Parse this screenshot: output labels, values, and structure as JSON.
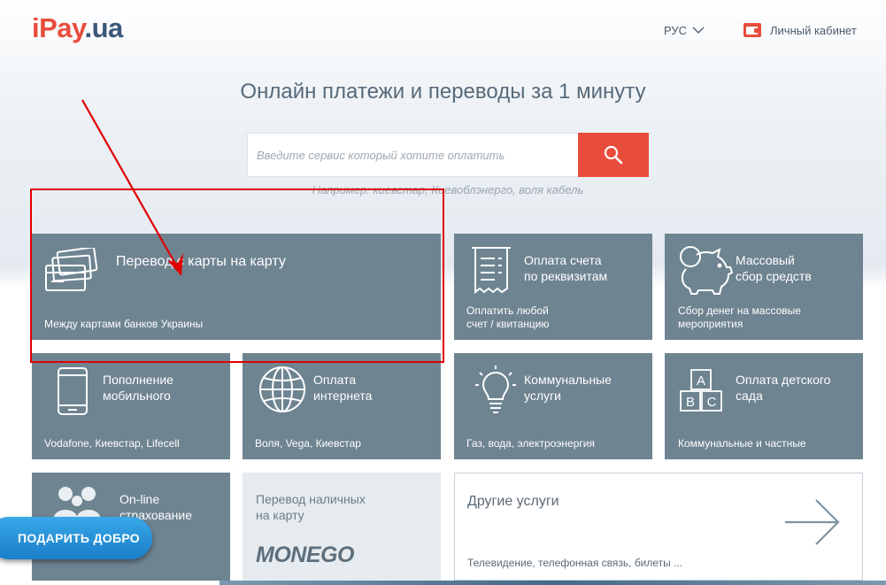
{
  "header": {
    "logo_main": "iPay",
    "logo_dot": ".",
    "logo_ua": "ua",
    "lang": "РУС",
    "cabinet": "Личный кабинет"
  },
  "hero": {
    "headline": "Онлайн платежи и переводы за 1 минуту",
    "search_placeholder": "Введите сервис который хотите оплатить",
    "example": "Например: киевстар, Киевоблэнерго, воля кабель"
  },
  "tiles": {
    "card": {
      "title": "Перевод с карты на карту",
      "sub": "Между картами банков Украины"
    },
    "invoice": {
      "title1": "Оплата счета",
      "title2": "по реквизитам",
      "sub1": "Оплатить любой",
      "sub2": "счет / квитанцию"
    },
    "mass": {
      "title1": "Массовый",
      "title2": "сбор средств",
      "sub1": "Сбор денег на массовые",
      "sub2": "мероприятия"
    },
    "mobile": {
      "title1": "Пополнение",
      "title2": "мобильного",
      "sub": "Vodafone, Киевстар, Lifecell"
    },
    "internet": {
      "title1": "Оплата",
      "title2": "интернета",
      "sub": "Воля, Vega, Киевстар"
    },
    "utilities": {
      "title1": "Коммунальные",
      "title2": "услуги",
      "sub": "Газ, вода, электроэнергия"
    },
    "kindergarten": {
      "title1": "Оплата детского",
      "title2": "сада",
      "sub": "Коммунальные и частные",
      "abc": [
        "A",
        "B",
        "C"
      ]
    },
    "insurance": {
      "title1": "On-line",
      "title2": "страхование"
    },
    "cash": {
      "title1": "Перевод наличных",
      "title2": "на карту",
      "brand": "MONEGO"
    },
    "other": {
      "title": "Другие услуги",
      "sub": "Телевидение, телефонная связь, билеты ..."
    }
  },
  "gift_button": "ПОДАРИТЬ ДОБРО",
  "colors": {
    "accent": "#e84c3d",
    "tile": "#6e8491",
    "highlight": "#e00000",
    "gift": "#1a8fd8"
  }
}
